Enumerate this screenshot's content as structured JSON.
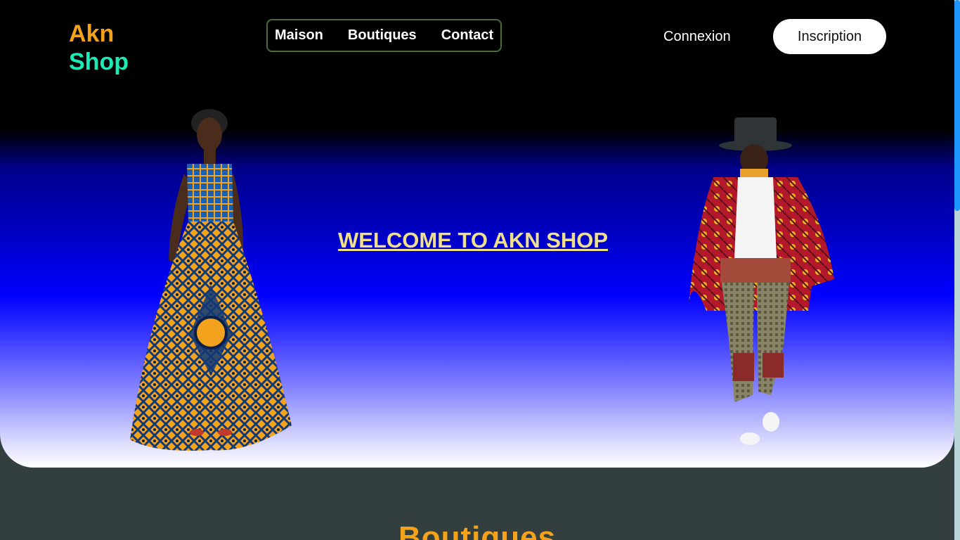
{
  "brand": {
    "line1": "Akn",
    "line2": "Shop"
  },
  "nav": {
    "items": [
      "Maison",
      "Boutiques",
      "Contact"
    ]
  },
  "auth": {
    "login": "Connexion",
    "signup": "Inscription"
  },
  "hero": {
    "welcome": "WELCOME TO AKN SHOP"
  },
  "sections": {
    "boutiques_title": "Boutiques"
  },
  "colors": {
    "accent_orange": "#f5a21b",
    "accent_teal": "#1de9b6",
    "welcome_text": "#f0e08a",
    "page_bg": "#333f3f"
  }
}
